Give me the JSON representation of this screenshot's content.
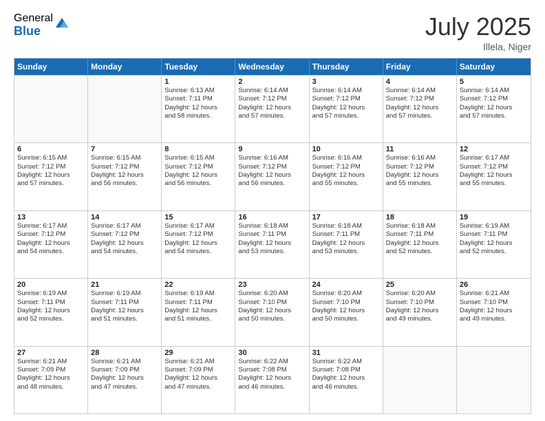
{
  "header": {
    "logo_general": "General",
    "logo_blue": "Blue",
    "month_title": "July 2025",
    "location": "Illela, Niger"
  },
  "weekdays": [
    "Sunday",
    "Monday",
    "Tuesday",
    "Wednesday",
    "Thursday",
    "Friday",
    "Saturday"
  ],
  "rows": [
    [
      {
        "day": "",
        "lines": []
      },
      {
        "day": "",
        "lines": []
      },
      {
        "day": "1",
        "lines": [
          "Sunrise: 6:13 AM",
          "Sunset: 7:11 PM",
          "Daylight: 12 hours",
          "and 58 minutes."
        ]
      },
      {
        "day": "2",
        "lines": [
          "Sunrise: 6:14 AM",
          "Sunset: 7:12 PM",
          "Daylight: 12 hours",
          "and 57 minutes."
        ]
      },
      {
        "day": "3",
        "lines": [
          "Sunrise: 6:14 AM",
          "Sunset: 7:12 PM",
          "Daylight: 12 hours",
          "and 57 minutes."
        ]
      },
      {
        "day": "4",
        "lines": [
          "Sunrise: 6:14 AM",
          "Sunset: 7:12 PM",
          "Daylight: 12 hours",
          "and 57 minutes."
        ]
      },
      {
        "day": "5",
        "lines": [
          "Sunrise: 6:14 AM",
          "Sunset: 7:12 PM",
          "Daylight: 12 hours",
          "and 57 minutes."
        ]
      }
    ],
    [
      {
        "day": "6",
        "lines": [
          "Sunrise: 6:15 AM",
          "Sunset: 7:12 PM",
          "Daylight: 12 hours",
          "and 57 minutes."
        ]
      },
      {
        "day": "7",
        "lines": [
          "Sunrise: 6:15 AM",
          "Sunset: 7:12 PM",
          "Daylight: 12 hours",
          "and 56 minutes."
        ]
      },
      {
        "day": "8",
        "lines": [
          "Sunrise: 6:15 AM",
          "Sunset: 7:12 PM",
          "Daylight: 12 hours",
          "and 56 minutes."
        ]
      },
      {
        "day": "9",
        "lines": [
          "Sunrise: 6:16 AM",
          "Sunset: 7:12 PM",
          "Daylight: 12 hours",
          "and 56 minutes."
        ]
      },
      {
        "day": "10",
        "lines": [
          "Sunrise: 6:16 AM",
          "Sunset: 7:12 PM",
          "Daylight: 12 hours",
          "and 55 minutes."
        ]
      },
      {
        "day": "11",
        "lines": [
          "Sunrise: 6:16 AM",
          "Sunset: 7:12 PM",
          "Daylight: 12 hours",
          "and 55 minutes."
        ]
      },
      {
        "day": "12",
        "lines": [
          "Sunrise: 6:17 AM",
          "Sunset: 7:12 PM",
          "Daylight: 12 hours",
          "and 55 minutes."
        ]
      }
    ],
    [
      {
        "day": "13",
        "lines": [
          "Sunrise: 6:17 AM",
          "Sunset: 7:12 PM",
          "Daylight: 12 hours",
          "and 54 minutes."
        ]
      },
      {
        "day": "14",
        "lines": [
          "Sunrise: 6:17 AM",
          "Sunset: 7:12 PM",
          "Daylight: 12 hours",
          "and 54 minutes."
        ]
      },
      {
        "day": "15",
        "lines": [
          "Sunrise: 6:17 AM",
          "Sunset: 7:12 PM",
          "Daylight: 12 hours",
          "and 54 minutes."
        ]
      },
      {
        "day": "16",
        "lines": [
          "Sunrise: 6:18 AM",
          "Sunset: 7:11 PM",
          "Daylight: 12 hours",
          "and 53 minutes."
        ]
      },
      {
        "day": "17",
        "lines": [
          "Sunrise: 6:18 AM",
          "Sunset: 7:11 PM",
          "Daylight: 12 hours",
          "and 53 minutes."
        ]
      },
      {
        "day": "18",
        "lines": [
          "Sunrise: 6:18 AM",
          "Sunset: 7:11 PM",
          "Daylight: 12 hours",
          "and 52 minutes."
        ]
      },
      {
        "day": "19",
        "lines": [
          "Sunrise: 6:19 AM",
          "Sunset: 7:11 PM",
          "Daylight: 12 hours",
          "and 52 minutes."
        ]
      }
    ],
    [
      {
        "day": "20",
        "lines": [
          "Sunrise: 6:19 AM",
          "Sunset: 7:11 PM",
          "Daylight: 12 hours",
          "and 52 minutes."
        ]
      },
      {
        "day": "21",
        "lines": [
          "Sunrise: 6:19 AM",
          "Sunset: 7:11 PM",
          "Daylight: 12 hours",
          "and 51 minutes."
        ]
      },
      {
        "day": "22",
        "lines": [
          "Sunrise: 6:19 AM",
          "Sunset: 7:11 PM",
          "Daylight: 12 hours",
          "and 51 minutes."
        ]
      },
      {
        "day": "23",
        "lines": [
          "Sunrise: 6:20 AM",
          "Sunset: 7:10 PM",
          "Daylight: 12 hours",
          "and 50 minutes."
        ]
      },
      {
        "day": "24",
        "lines": [
          "Sunrise: 6:20 AM",
          "Sunset: 7:10 PM",
          "Daylight: 12 hours",
          "and 50 minutes."
        ]
      },
      {
        "day": "25",
        "lines": [
          "Sunrise: 6:20 AM",
          "Sunset: 7:10 PM",
          "Daylight: 12 hours",
          "and 49 minutes."
        ]
      },
      {
        "day": "26",
        "lines": [
          "Sunrise: 6:21 AM",
          "Sunset: 7:10 PM",
          "Daylight: 12 hours",
          "and 49 minutes."
        ]
      }
    ],
    [
      {
        "day": "27",
        "lines": [
          "Sunrise: 6:21 AM",
          "Sunset: 7:09 PM",
          "Daylight: 12 hours",
          "and 48 minutes."
        ]
      },
      {
        "day": "28",
        "lines": [
          "Sunrise: 6:21 AM",
          "Sunset: 7:09 PM",
          "Daylight: 12 hours",
          "and 47 minutes."
        ]
      },
      {
        "day": "29",
        "lines": [
          "Sunrise: 6:21 AM",
          "Sunset: 7:09 PM",
          "Daylight: 12 hours",
          "and 47 minutes."
        ]
      },
      {
        "day": "30",
        "lines": [
          "Sunrise: 6:22 AM",
          "Sunset: 7:08 PM",
          "Daylight: 12 hours",
          "and 46 minutes."
        ]
      },
      {
        "day": "31",
        "lines": [
          "Sunrise: 6:22 AM",
          "Sunset: 7:08 PM",
          "Daylight: 12 hours",
          "and 46 minutes."
        ]
      },
      {
        "day": "",
        "lines": []
      },
      {
        "day": "",
        "lines": []
      }
    ]
  ]
}
